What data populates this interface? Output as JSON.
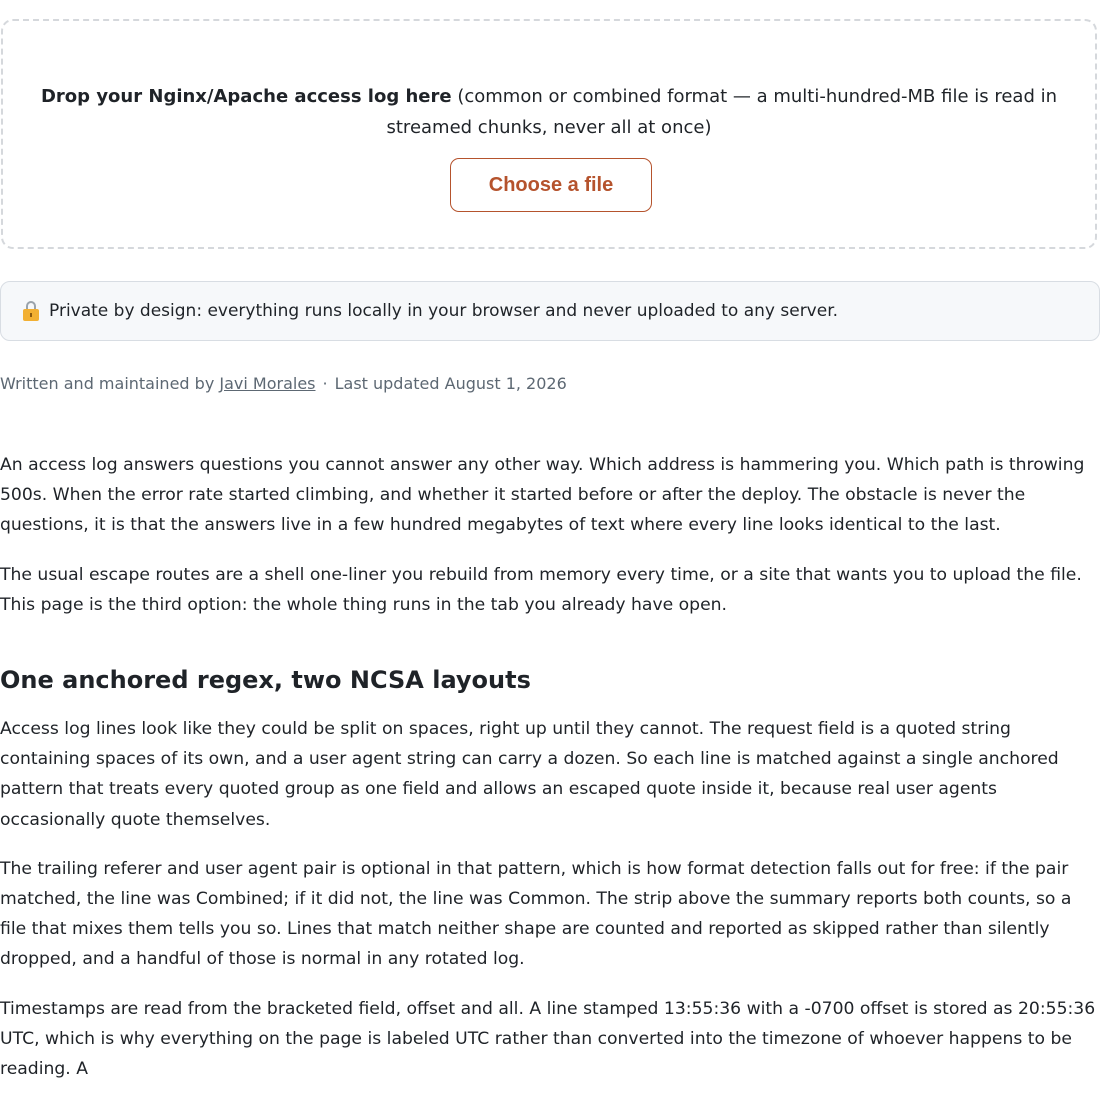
{
  "upload": {
    "bold_text": "Drop your Nginx/Apache access log here",
    "rest_text": " (common or combined format — a multi-hundred-MB file is read in streamed chunks, never all at once)",
    "button_label": "Choose a file",
    "accent_color": "#b5532d"
  },
  "privacy": {
    "icon": "lock-icon",
    "text": "Private by design: everything runs locally in your browser and never uploaded to any server."
  },
  "byline": {
    "prefix": "Written and maintained by ",
    "author": "Javi Morales",
    "separator": "·",
    "updated": "Last updated August 1, 2026"
  },
  "article": {
    "intro": [
      "An access log answers questions you cannot answer any other way. Which address is hammering you. Which path is throwing 500s. When the error rate started climbing, and whether it started before or after the deploy. The obstacle is never the questions, it is that the answers live in a few hundred megabytes of text where every line looks identical to the last.",
      "The usual escape routes are a shell one-liner you rebuild from memory every time, or a site that wants you to upload the file. This page is the third option: the whole thing runs in the tab you already have open."
    ],
    "section1": {
      "heading": "One anchored regex, two NCSA layouts",
      "paragraphs": [
        "Access log lines look like they could be split on spaces, right up until they cannot. The request field is a quoted string containing spaces of its own, and a user agent string can carry a dozen. So each line is matched against a single anchored pattern that treats every quoted group as one field and allows an escaped quote inside it, because real user agents occasionally quote themselves.",
        "The trailing referer and user agent pair is optional in that pattern, which is how format detection falls out for free: if the pair matched, the line was Combined; if it did not, the line was Common. The strip above the summary reports both counts, so a file that mixes them tells you so. Lines that match neither shape are counted and reported as skipped rather than silently dropped, and a handful of those is normal in any rotated log.",
        "Timestamps are read from the bracketed field, offset and all. A line stamped 13:55:36 with a -0700 offset is stored as 20:55:36 UTC, which is why everything on the page is labeled UTC rather than converted into the timezone of whoever happens to be reading. A"
      ]
    }
  }
}
